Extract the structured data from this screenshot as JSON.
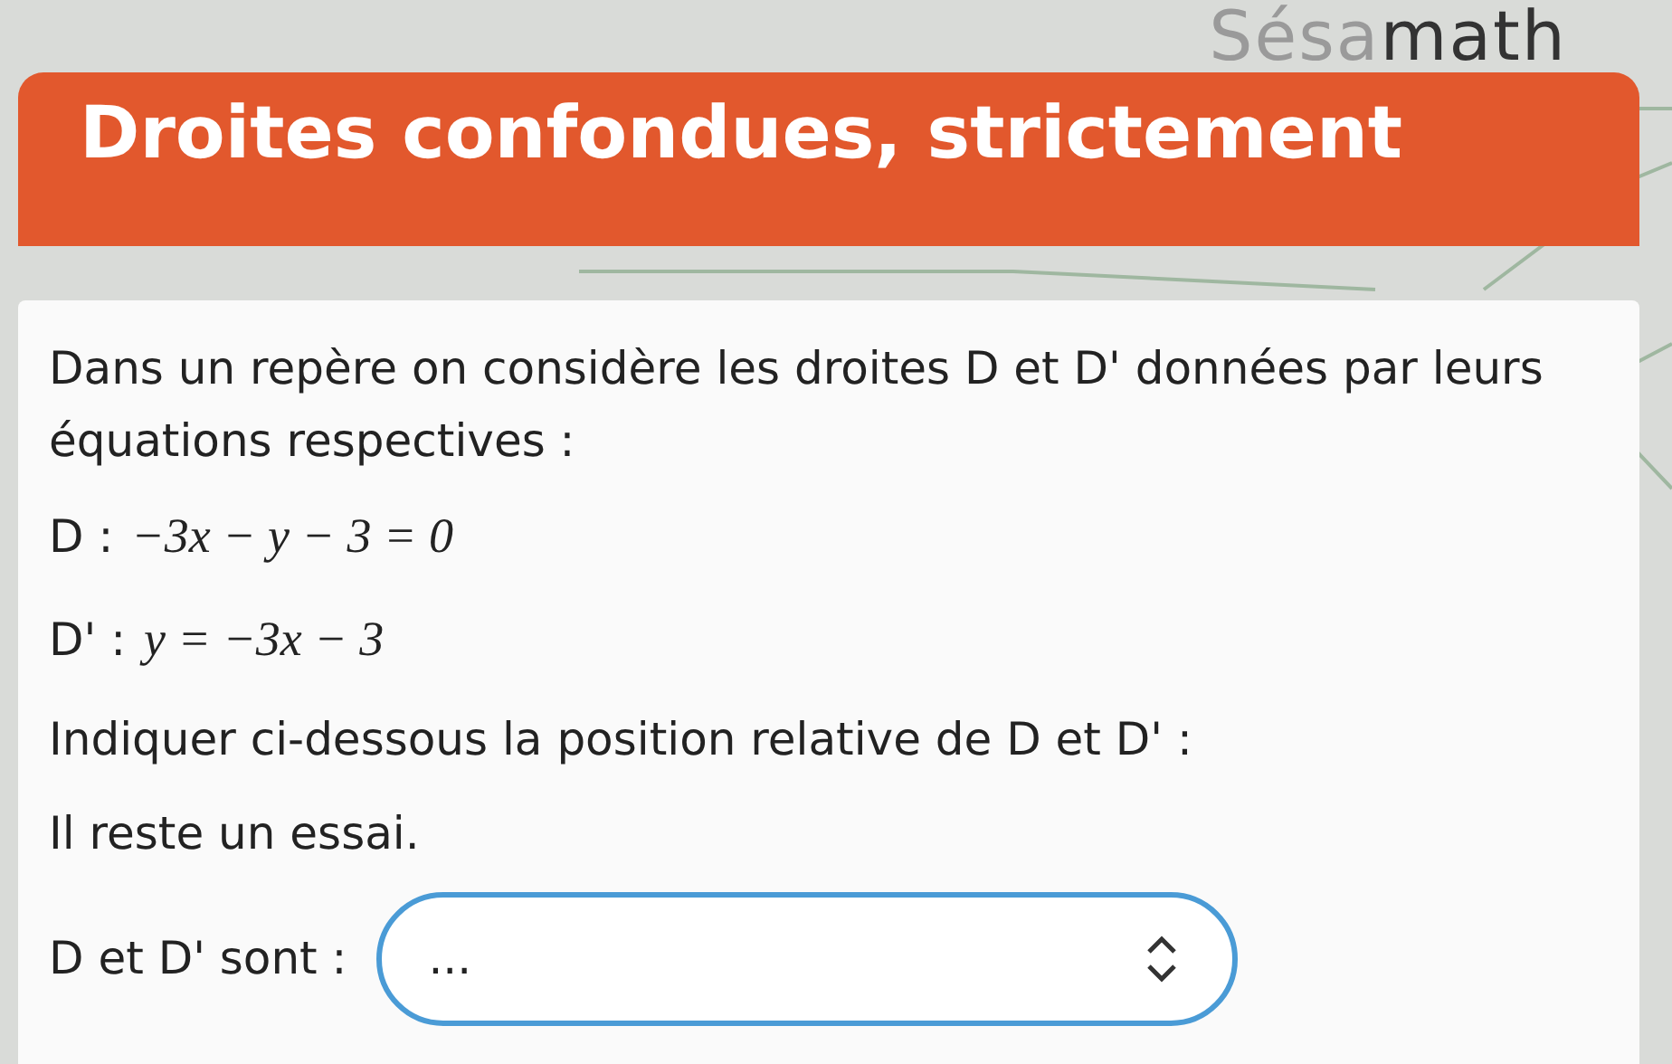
{
  "logo": {
    "part_1": "Sésa",
    "part_2": "math"
  },
  "title": "Droites confondues, strictement",
  "intro": "Dans un repère on considère les droites D et D' données par leurs équations respectives :",
  "equations": [
    {
      "label": "D :",
      "equation": "−3x − y − 3 = 0"
    },
    {
      "label": "D' :",
      "equation": "y = −3x − 3"
    }
  ],
  "question": "Indiquer ci-dessous la position relative de D et D' :",
  "attempts": "Il reste un essai.",
  "answer": {
    "label": "D et D' sont :",
    "value": "..."
  }
}
